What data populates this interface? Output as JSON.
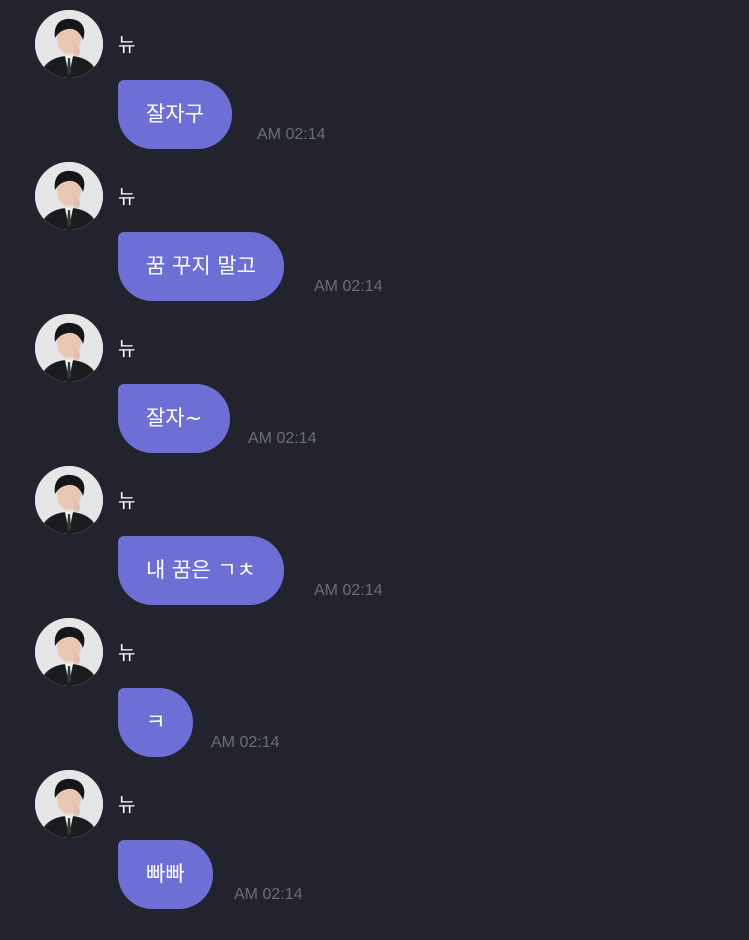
{
  "chat": {
    "messages": [
      {
        "sender": "뉴",
        "text": "잘자구",
        "time": "AM 02:14"
      },
      {
        "sender": "뉴",
        "text": "꿈 꾸지 말고",
        "time": "AM 02:14"
      },
      {
        "sender": "뉴",
        "text": "잘자~",
        "time": "AM 02:14"
      },
      {
        "sender": "뉴",
        "text": "내 꿈은 ㄱㅊ",
        "time": "AM 02:14"
      },
      {
        "sender": "뉴",
        "text": "ㅋ",
        "time": "AM 02:14"
      },
      {
        "sender": "뉴",
        "text": "빠빠",
        "time": "AM 02:14"
      }
    ]
  },
  "colors": {
    "background": "#22232c",
    "bubble": "#6e6fd4",
    "timestamp": "#6c6d7a",
    "text": "#ffffff"
  },
  "icons": {
    "avatar": "user-avatar-photo"
  }
}
